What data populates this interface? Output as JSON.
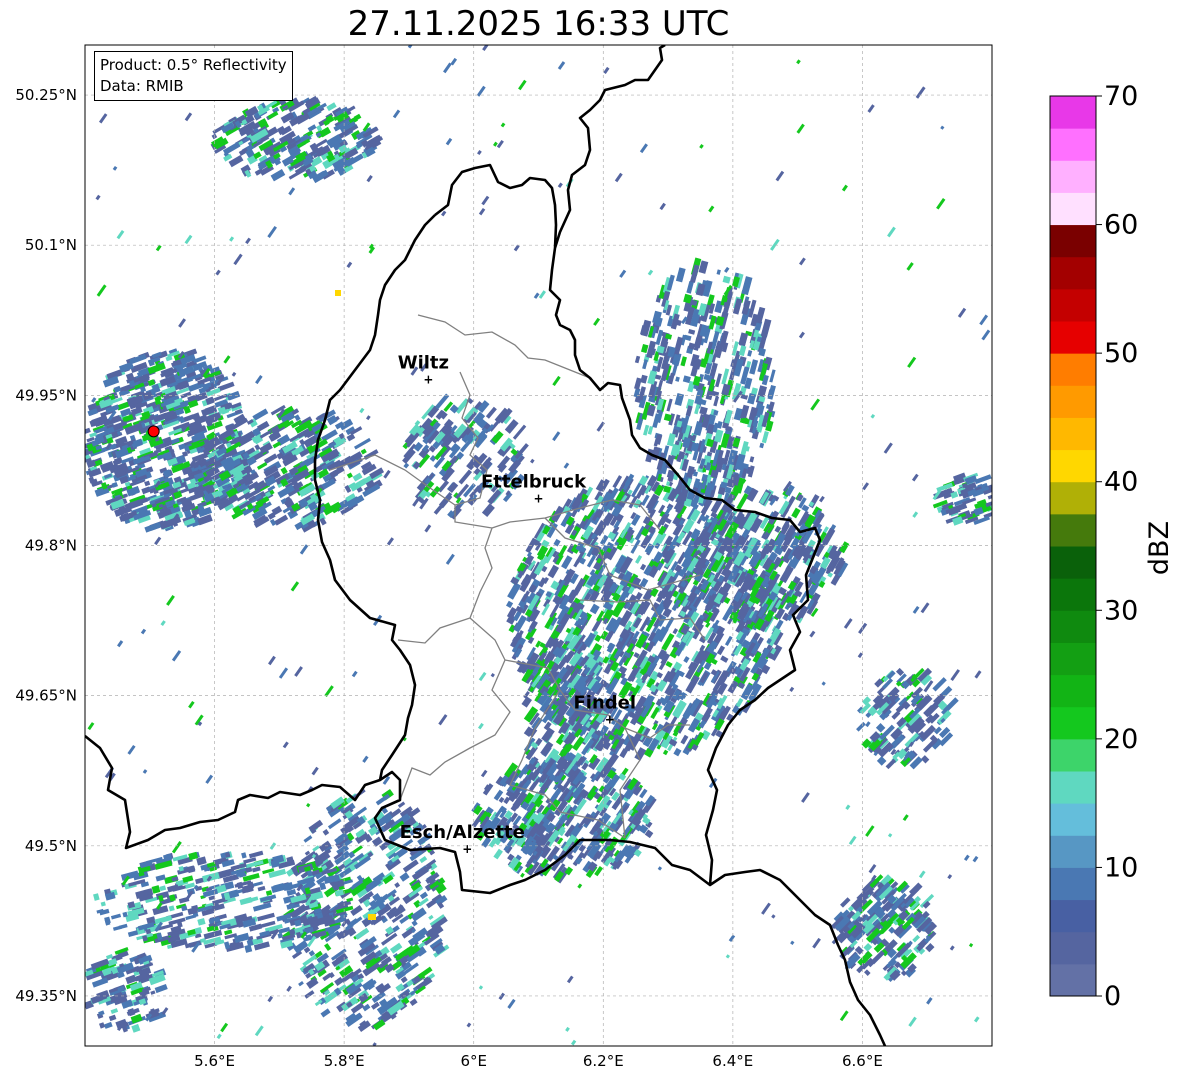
{
  "title": "27.11.2025 16:33 UTC",
  "info": {
    "product": "Product: 0.5° Reflectivity",
    "data": "Data: RMIB"
  },
  "map": {
    "lon_range": [
      5.4,
      6.8
    ],
    "lat_range": [
      49.3,
      50.3
    ],
    "x_ticks": [
      {
        "value": 5.6,
        "label": "5.6°E"
      },
      {
        "value": 5.8,
        "label": "5.8°E"
      },
      {
        "value": 6.0,
        "label": "6°E"
      },
      {
        "value": 6.2,
        "label": "6.2°E"
      },
      {
        "value": 6.4,
        "label": "6.4°E"
      },
      {
        "value": 6.6,
        "label": "6.6°E"
      }
    ],
    "y_ticks": [
      {
        "value": 50.25,
        "label": "50.25°N"
      },
      {
        "value": 50.1,
        "label": "50.1°N"
      },
      {
        "value": 49.95,
        "label": "49.95°N"
      },
      {
        "value": 49.8,
        "label": "49.8°N"
      },
      {
        "value": 49.65,
        "label": "49.65°N"
      },
      {
        "value": 49.5,
        "label": "49.5°N"
      },
      {
        "value": 49.35,
        "label": "49.35°N"
      }
    ],
    "grid": true,
    "cities": [
      {
        "name": "Wiltz",
        "lon": 5.93,
        "lat": 49.967
      },
      {
        "name": "Ettelbruck",
        "lon": 6.1,
        "lat": 49.848
      },
      {
        "name": "Findel",
        "lon": 6.21,
        "lat": 49.627
      },
      {
        "name": "Esch/Alzette",
        "lon": 5.99,
        "lat": 49.498
      }
    ],
    "radar_site": {
      "lon": 5.506,
      "lat": 49.914
    }
  },
  "colorbar": {
    "label": "dBZ",
    "min": 0,
    "max": 70,
    "ticks": [
      {
        "value": 0,
        "label": "0"
      },
      {
        "value": 10,
        "label": "10"
      },
      {
        "value": 20,
        "label": "20"
      },
      {
        "value": 30,
        "label": "30"
      },
      {
        "value": 40,
        "label": "40"
      },
      {
        "value": 50,
        "label": "50"
      },
      {
        "value": 60,
        "label": "60"
      },
      {
        "value": 70,
        "label": "70"
      }
    ],
    "colors": [
      "#6371a6",
      "#5565a0",
      "#4860a3",
      "#4a78b3",
      "#5797c4",
      "#64bedb",
      "#5fd8c0",
      "#3dd46a",
      "#14c81e",
      "#12b415",
      "#139f13",
      "#0f8a0f",
      "#0b760b",
      "#0a610a",
      "#457a0c",
      "#b0b006",
      "#ffd700",
      "#ffb800",
      "#ff9a00",
      "#ff7d00",
      "#e60000",
      "#c40000",
      "#a30000",
      "#7a0000",
      "#ffe0ff",
      "#ffb0ff",
      "#ff70ff",
      "#e838e8"
    ]
  },
  "precip_colors": {
    "light": "#5565a0",
    "medium": "#4a78b3",
    "teal": "#5fd8c0",
    "green": "#14c81e",
    "yellow": "#ffd700"
  }
}
